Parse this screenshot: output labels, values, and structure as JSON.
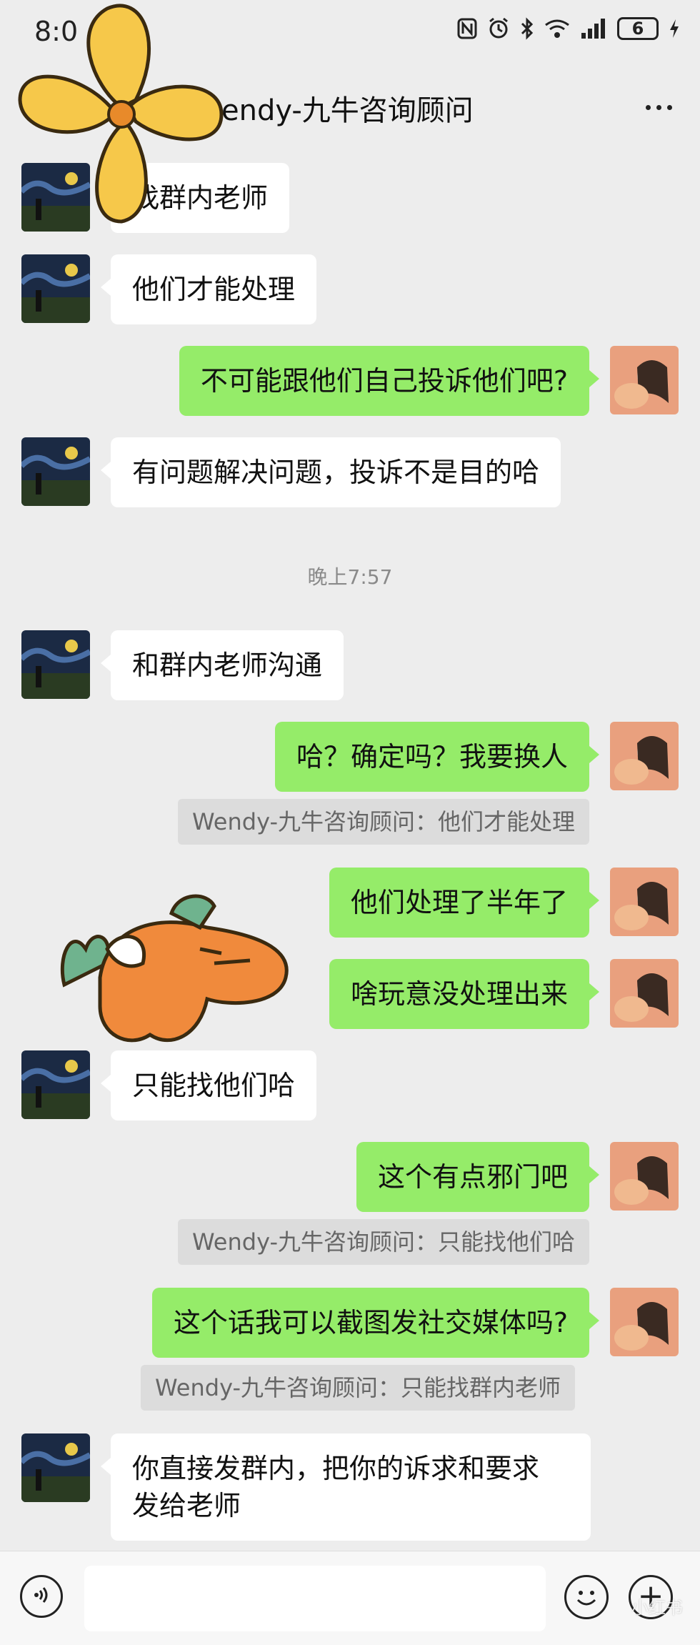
{
  "status_bar": {
    "time": "8:0",
    "battery": "6"
  },
  "header": {
    "title": "endy-九牛咨询顾问",
    "more_icon": "more-dots-icon"
  },
  "messages": [
    {
      "side": "left",
      "text": "找群内老师"
    },
    {
      "side": "left",
      "text": "他们才能处理"
    },
    {
      "side": "right",
      "text": "不可能跟他们自己投诉他们吧?"
    },
    {
      "side": "left",
      "text": "有问题解决问题，投诉不是目的哈"
    },
    {
      "timestamp": "晚上7:57"
    },
    {
      "side": "left",
      "text": "和群内老师沟通"
    },
    {
      "side": "right",
      "text": "哈？确定吗？我要换人",
      "quote": "Wendy-九牛咨询顾问：他们才能处理"
    },
    {
      "side": "right",
      "text": "他们处理了半年了"
    },
    {
      "side": "right",
      "text": "啥玩意没处理出来"
    },
    {
      "side": "left",
      "text": "只能找他们哈"
    },
    {
      "side": "right",
      "text": "这个有点邪门吧",
      "quote": "Wendy-九牛咨询顾问：只能找他们哈"
    },
    {
      "side": "right",
      "text": "这个话我可以截图发社交媒体吗?",
      "quote": "Wendy-九牛咨询顾问：只能找群内老师"
    },
    {
      "side": "left",
      "text": "你直接发群内，把你的诉求和要求",
      "text2": "发给老师"
    }
  ],
  "input_bar": {
    "voice_icon": "voice-icon",
    "emoji_icon": "emoji-icon",
    "plus_icon": "plus-icon"
  },
  "watermark": "小红书"
}
